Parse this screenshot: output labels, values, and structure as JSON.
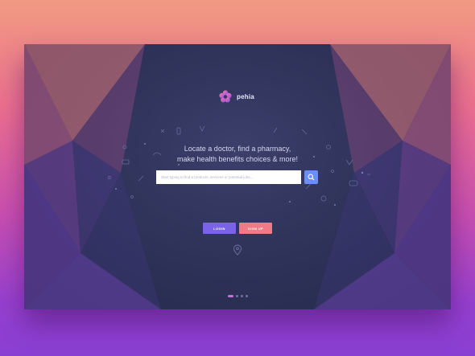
{
  "brand": {
    "name": "pehia"
  },
  "hero": {
    "headline_line1": "Locate a doctor, find a pharmacy,",
    "headline_line2": "make health benefits choices & more!"
  },
  "search": {
    "placeholder": "Start typing to find a products, services or potential jobs...",
    "button_icon": "search-icon"
  },
  "actions": {
    "login_label": "LOGIN",
    "signup_label": "SIGN UP"
  },
  "pagination": {
    "count": 4,
    "active": 1
  },
  "colors": {
    "accent_blue": "#6c8ff5",
    "login": "#7b63e8",
    "signup": "#f07a86",
    "panel": "#2d3157"
  }
}
